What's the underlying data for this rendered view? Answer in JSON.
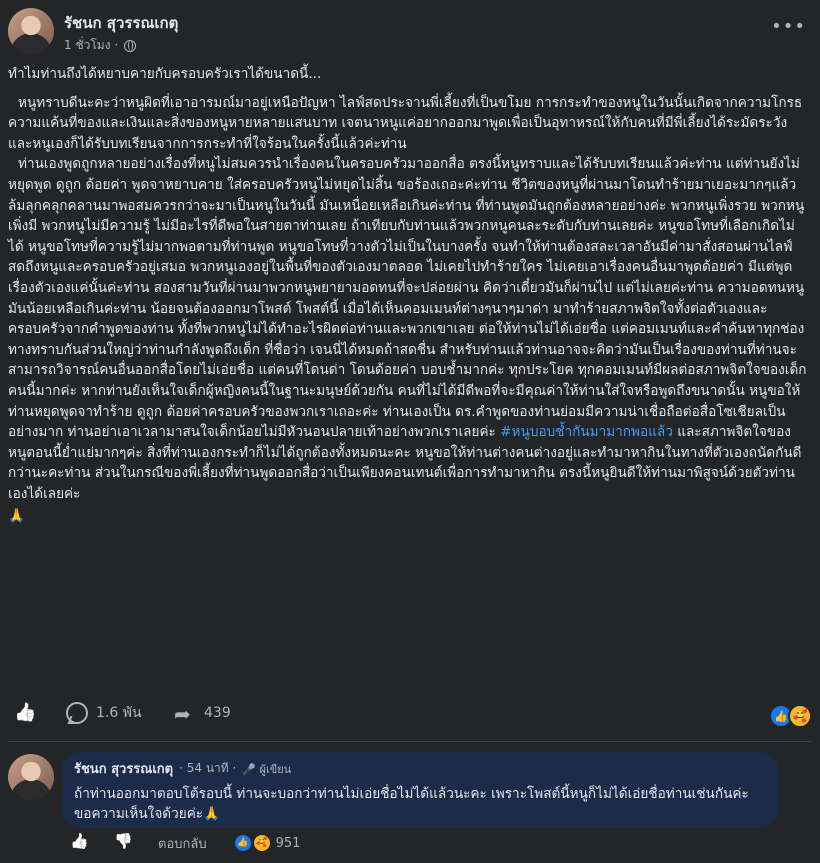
{
  "post": {
    "author": "รัชนก สุวรรณเกตุ",
    "time": "1 ชั่วโมง ·",
    "title": "ทำไมท่านถึงได้หยาบคายกับครอบครัวเราได้ขนาดนี้...",
    "paragraphs": [
      "หนูทราบดีนะคะว่าหนูผิดที่เอาอารมณ์มาอยู่เหนือปัญหา ไลฟ์สดประจานพี่เลี้ยงที่เป็นขโมย การกระทำของหนูในวันนั้นเกิดจากความโกรธความแค้นที่ของและเงินและสิ่งของหนูหายหลายแสนบาท เจตนาหนูแค่อยากออกมาพูดเพื่อเป็นอุทาหรณ์ให้กับคนที่มีพี่เลี้ยงได้ระมัดระวัง และหนูเองก็ได้รับบทเรียนจากการกระทำที่ใจร้อนในครั้งนี้แล้วค่ะท่าน",
      "ท่านเองพูดถูกหลายอย่างเรื่องที่หนูไม่สมควรนำเรื่องคนในครอบครัวมาออกสื่อ ตรงนี้หนูทราบและได้รับบทเรียนแล้วค่ะท่าน แต่ท่านยังไม่หยุดพูด ดูถูก ด้อยค่า พูดจาหยาบคาย ใส่ครอบครัวหนูไม่หยุดไม่สิ้น ขอร้องเถอะค่ะท่าน ชีวิตของหนูที่ผ่านมาโดนทำร้ายมาเยอะมากๆแล้ว ล้มลุกคลุกคลานมาพอสมควรกว่าจะมาเป็นหนูในวันนี้ มันเหนื่อยเหลือเกินค่ะท่าน ที่ท่านพูดมันถูกต้องหลายอย่างค่ะ พวกหนูเพิ่งรวย พวกหนูเพิ่งมี พวกหนูไม่มีความรู้ ไม่มีอะไรที่ดีพอในสายตาท่านเลย ถ้าเทียบกับท่านแล้วพวกหนูคนละระดับกับท่านเลยค่ะ หนูขอโทษที่เลือกเกิดไม่ได้ หนูขอโทษที่ความรู้ไม่มากพอตามที่ท่านพูด หนูขอโทษที่วางตัวไม่เป็นในบางครั้ง จนทำให้ท่านต้องสละเวลาอันมีค่ามาสั่งสอนผ่านไลฟ์สดถึงหนูและครอบครัวอยู่เสมอ พวกหนูเองอยู่ในพื้นที่ของตัวเองมาตลอด ไม่เคยไปทำร้ายใคร ไม่เคยเอาเรื่องคนอื่นมาพูดด้อยค่า มีแต่พูดเรื่องตัวเองแค่นั้นค่ะท่าน สองสามวันที่ผ่านมาพวกหนูพยายามอดทนที่จะปล่อยผ่าน คิดว่าเดี๋ยวมันก็ผ่านไป แต่ไม่เลยค่ะท่าน ความอดทนหนูมันน้อยเหลือเกินค่ะท่าน น้อยจนต้องออกมาโพสต์ โพสต์นี้ เมื่อได้เห็นคอมเมนท์ต่างๆนาๆมาด่า มาทำร้ายสภาพจิตใจทั้งต่อตัวเองและครอบครัวจากคำพูดของท่าน ทั้งที่พวกหนูไม่ได้ทำอะไรผิดต่อท่านและพวกเขาเลย ต่อให้ท่านไม่ได้เอ่ยชื่อ แต่คอมเมนท์และคำค้นหาทุกช่องทางทราบกันส่วนใหญ่ว่าท่านกำลังพูดถึงเด็ก ที่ชื่อว่า เจนนี่ได้หมดถ้าสดชื่น สำหรับท่านแล้วท่านอาจจะคิดว่ามันเป็นเรื่องของท่านที่ท่านจะสามารถวิจารณ์คนอื่นออกสื่อโดยไม่เอ่ยชื่อ แต่คนที่โดนด่า โดนด้อยค่า บอบช้ำมากค่ะ ทุกประโยค ทุกคอมเมนท์มีผลต่อสภาพจิตใจของเด็กคนนี้มากค่ะ หากท่านยังเห็นใจเด็กผู้หญิงคนนี้ในฐานะมนุษย์ด้วยกัน คนที่ไม่ได้มีดีพอที่จะมีคุณค่าให้ท่านใส่ใจหรือพูดถึงขนาดนั้น หนูขอให้ท่านหยุดพูดจาทำร้าย ดูถูก ด้อยค่าครอบครัวของพวกเราเถอะค่ะ ท่านเองเป็น ดร.คำพูดของท่านย่อมมีความน่าเชื่อถือต่อสื่อโซเชียลเป็นอย่างมาก ท่านอย่าเอาเวลามาสนใจเด็กน้อยไม่มีหัวนอนปลายเท้าอย่างพวกเราเลยค่ะ"
    ],
    "hashtag": "#หนูบอบช้ำกันมามากพอแล้ว",
    "after_hashtag": " และสภาพจิตใจของหนูตอนนี้ย่ำแย่มากๆค่ะ สิ่งที่ท่านเองกระทำก็ไม่ได้ถูกต้องทั้งหมดนะคะ หนูขอให้ท่านต่างคนต่างอยู่และทำมาหากินในทางที่ตัวเองถนัดกันดีกว่านะคะท่าน ส่วนในกรณีของพี่เลี้ยงที่ท่านพูดออกสื่อว่าเป็นเพียงคอนเทนต์เพื่อการทำมาหากิน ตรงนี้หนูยินดีให้ท่านมาพิสูจน์ด้วยตัวท่านเองได้เลยค่ะ",
    "end_emoji": "🙏",
    "comment_count": "1.6 พัน",
    "share_count": "439"
  },
  "icons": {
    "privacy": "globe-icon",
    "more": "more-options-icon",
    "like": "like-icon",
    "comment": "comment-icon",
    "share": "share-icon"
  },
  "comment": {
    "author": "รัชนก สุวรรณเกตุ",
    "time": "· 54 นาที ·",
    "badge": "🎤 ผู้เขียน",
    "text": "ถ้าท่านออกมาตอบโต้รอบนี้ ท่านจะบอกว่าท่านไม่เอ่ยชื่อไม่ได้แล้วนะคะ เพราะโพสต์นี้หนูก็ไม่ได้เอ่ยชื่อท่านเช่นกันค่ะ ขอความเห็นใจด้วยค่ะ🙏",
    "reply_label": "ตอบกลับ",
    "reaction_count": "951"
  },
  "colors": {
    "background": "#242526",
    "text": "#e4e6eb",
    "muted": "#b0b3b8",
    "hashtag": "#4599ff",
    "comment_bubble": "#1c2b4a"
  }
}
